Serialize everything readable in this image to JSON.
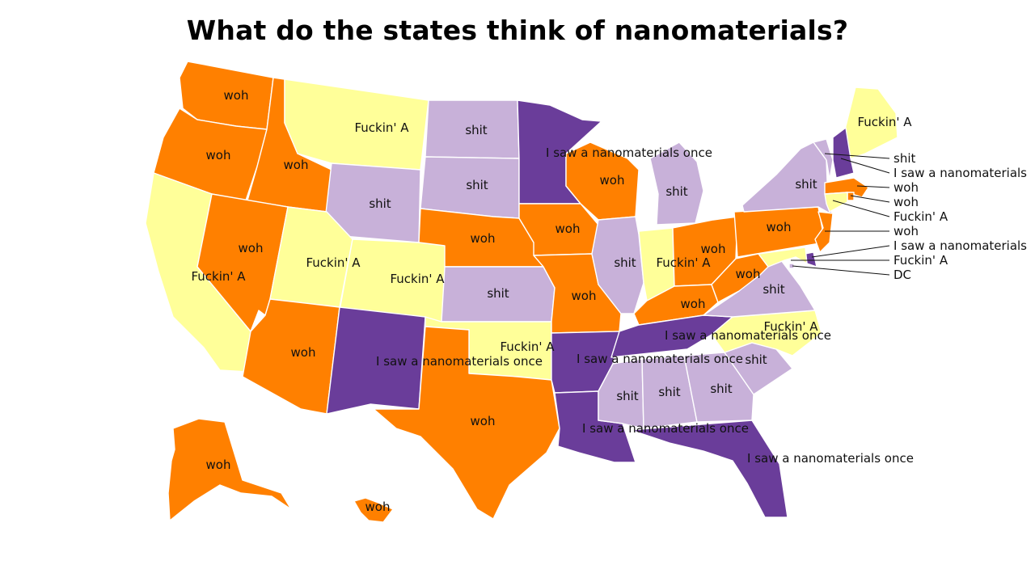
{
  "title": "What do the states think of nanomaterials?",
  "categories": {
    "woh": {
      "label": "woh",
      "color": "#FF8000"
    },
    "shit": {
      "label": "shit",
      "color": "#C8B1D9"
    },
    "fuckin": {
      "label": "Fuckin' A",
      "color": "#FFFF99"
    },
    "saw": {
      "label": "I saw a nanomaterials once",
      "color": "#6A3D9A"
    }
  },
  "states": [
    {
      "id": "washington",
      "category": "woh",
      "label": "woh"
    },
    {
      "id": "oregon",
      "category": "woh",
      "label": "woh"
    },
    {
      "id": "california",
      "category": "fuckin",
      "label": "Fuckin' A"
    },
    {
      "id": "idaho",
      "category": "woh",
      "label": "woh"
    },
    {
      "id": "nevada",
      "category": "woh",
      "label": "woh"
    },
    {
      "id": "montana",
      "category": "fuckin",
      "label": "Fuckin' A"
    },
    {
      "id": "wyoming",
      "category": "shit",
      "label": "shit"
    },
    {
      "id": "utah",
      "category": "fuckin",
      "label": "Fuckin' A"
    },
    {
      "id": "colorado",
      "category": "fuckin",
      "label": "Fuckin' A"
    },
    {
      "id": "arizona",
      "category": "woh",
      "label": "woh"
    },
    {
      "id": "new-mexico",
      "category": "saw",
      "label": "I saw a nanomaterials once"
    },
    {
      "id": "north-dakota",
      "category": "shit",
      "label": "shit"
    },
    {
      "id": "south-dakota",
      "category": "shit",
      "label": "shit"
    },
    {
      "id": "nebraska",
      "category": "woh",
      "label": "woh"
    },
    {
      "id": "kansas",
      "category": "shit",
      "label": "shit"
    },
    {
      "id": "oklahoma",
      "category": "fuckin",
      "label": "Fuckin' A"
    },
    {
      "id": "texas",
      "category": "woh",
      "label": "woh"
    },
    {
      "id": "minnesota",
      "category": "saw",
      "label": "I saw a nanomaterials once"
    },
    {
      "id": "iowa",
      "category": "woh",
      "label": "woh"
    },
    {
      "id": "missouri",
      "category": "woh",
      "label": "woh"
    },
    {
      "id": "arkansas",
      "category": "saw",
      "label": "I saw a nanomaterials once"
    },
    {
      "id": "louisiana",
      "category": "saw",
      "label": "I saw a nanomaterials once"
    },
    {
      "id": "wisconsin",
      "category": "woh",
      "label": "woh"
    },
    {
      "id": "illinois",
      "category": "shit",
      "label": "shit"
    },
    {
      "id": "michigan",
      "category": "shit",
      "label": "shit"
    },
    {
      "id": "indiana",
      "category": "fuckin",
      "label": "Fuckin' A"
    },
    {
      "id": "ohio",
      "category": "woh",
      "label": "woh"
    },
    {
      "id": "kentucky",
      "category": "woh",
      "label": "woh"
    },
    {
      "id": "tennessee",
      "category": "saw",
      "label": "I saw a nanomaterials once"
    },
    {
      "id": "mississippi",
      "category": "shit",
      "label": "shit"
    },
    {
      "id": "alabama",
      "category": "shit",
      "label": "shit"
    },
    {
      "id": "georgia",
      "category": "shit",
      "label": "shit"
    },
    {
      "id": "florida",
      "category": "saw",
      "label": "I saw a nanomaterials once"
    },
    {
      "id": "south-carolina",
      "category": "shit",
      "label": "shit"
    },
    {
      "id": "north-carolina",
      "category": "fuckin",
      "label": "Fuckin' A"
    },
    {
      "id": "virginia",
      "category": "shit",
      "label": "shit"
    },
    {
      "id": "west-virginia",
      "category": "woh",
      "label": "woh"
    },
    {
      "id": "pennsylvania",
      "category": "woh",
      "label": "woh"
    },
    {
      "id": "new-york",
      "category": "shit",
      "label": "shit"
    },
    {
      "id": "maine",
      "category": "fuckin",
      "label": "Fuckin' A"
    },
    {
      "id": "alaska",
      "category": "woh",
      "label": "woh"
    },
    {
      "id": "hawaii",
      "category": "woh",
      "label": "woh"
    }
  ],
  "small_states": [
    {
      "id": "vermont",
      "category": "shit",
      "label": "shit"
    },
    {
      "id": "new-hampshire",
      "category": "saw",
      "label": "I saw a nanomaterials"
    },
    {
      "id": "massachusetts",
      "category": "woh",
      "label": "woh"
    },
    {
      "id": "rhode-island",
      "category": "woh",
      "label": "woh"
    },
    {
      "id": "connecticut",
      "category": "fuckin",
      "label": "Fuckin' A"
    },
    {
      "id": "new-jersey",
      "category": "woh",
      "label": "woh"
    },
    {
      "id": "delaware",
      "category": "saw",
      "label": "I saw a nanomaterials"
    },
    {
      "id": "maryland",
      "category": "fuckin",
      "label": "Fuckin' A"
    },
    {
      "id": "dc",
      "category": "shit",
      "label": "DC"
    }
  ]
}
